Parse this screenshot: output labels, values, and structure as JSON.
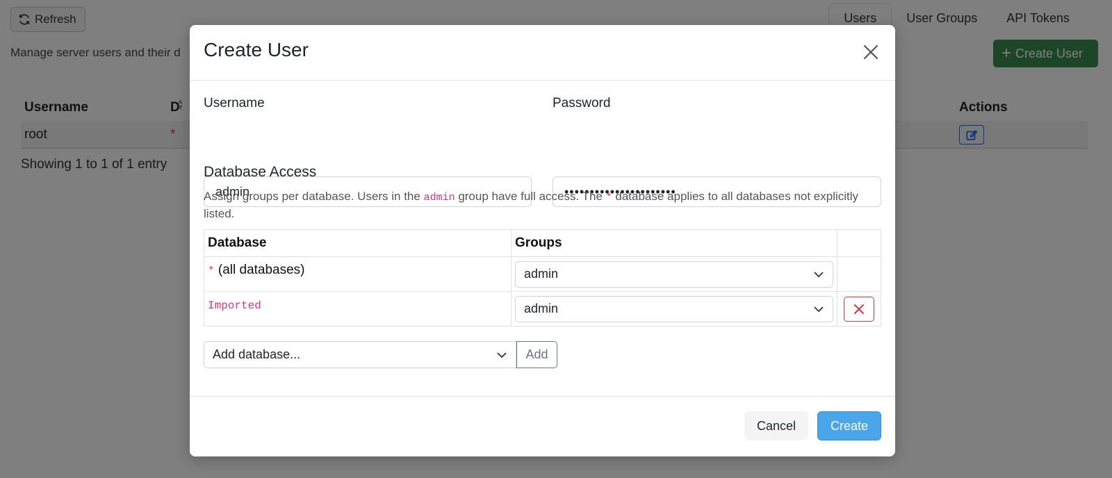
{
  "background": {
    "refresh_label": "Refresh",
    "tabs": [
      {
        "label": "Users",
        "active": true
      },
      {
        "label": "User Groups",
        "active": false
      },
      {
        "label": "API Tokens",
        "active": false
      }
    ],
    "description": "Manage server users and their d",
    "create_user_label": "Create User",
    "table": {
      "col_username": "Username",
      "col_d": "D",
      "col_actions": "Actions",
      "rows": [
        {
          "username": "root",
          "db": "*"
        }
      ]
    },
    "info": "Showing 1 to 1 of 1 entry"
  },
  "modal": {
    "title": "Create User",
    "username_label": "Username",
    "username_value": "admin",
    "password_label": "Password",
    "password_value": "••••••••••••••••••••••",
    "section_title": "Database Access",
    "help": {
      "part1": "Assign groups per database. Users in the ",
      "code1": "admin",
      "part2": " group have full access. The ",
      "code2": "*",
      "part3": " database applies to all databases not explicitly listed."
    },
    "table": {
      "col_database": "Database",
      "col_groups": "Groups",
      "rows": [
        {
          "db_code": "*",
          "db_label": " (all databases)",
          "group": "admin",
          "removable": false
        },
        {
          "db_code": "Imported",
          "db_label": "",
          "group": "admin",
          "removable": true
        }
      ]
    },
    "add_database_placeholder": "Add database...",
    "add_label": "Add",
    "cancel_label": "Cancel",
    "create_label": "Create"
  },
  "colors": {
    "backdrop": "#00000080",
    "primary": "#4aa6e8",
    "success": "#3b8a51",
    "danger": "#dc3545",
    "code": "#d63384"
  }
}
